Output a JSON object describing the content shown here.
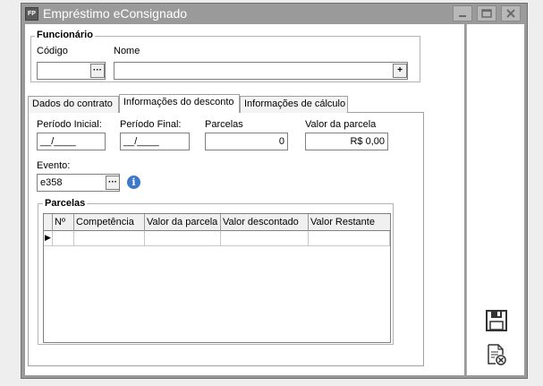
{
  "window": {
    "app_icon_text": "FP",
    "title": "Empréstimo eConsignado"
  },
  "funcionario": {
    "group_title": "Funcionário",
    "codigo_label": "Código",
    "codigo_value": "",
    "codigo_button": "···",
    "nome_label": "Nome",
    "nome_value": "",
    "nome_button": "+"
  },
  "tabs": [
    {
      "label": "Dados do contrato",
      "active": false
    },
    {
      "label": "Informações do desconto",
      "active": true
    },
    {
      "label": "Informações de cálculo",
      "active": false
    }
  ],
  "desconto": {
    "periodo_inicial_label": "Período Inicial:",
    "periodo_inicial_value": "__/____",
    "periodo_final_label": "Período Final:",
    "periodo_final_value": "__/____",
    "parcelas_label": "Parcelas",
    "parcelas_value": "0",
    "valor_parcela_label": "Valor da parcela",
    "valor_parcela_value": "R$ 0,00",
    "evento_label": "Evento:",
    "evento_value": "e358",
    "evento_button": "···",
    "info_icon_text": "i"
  },
  "parcelas": {
    "group_title": "Parcelas",
    "columns": [
      "Nº",
      "Competência",
      "Valor da parcela",
      "Valor descontado",
      "Valor Restante"
    ],
    "row_indicator": "▶"
  },
  "side": {
    "save_icon": "save-icon",
    "cancel_icon": "cancel-document-icon"
  }
}
